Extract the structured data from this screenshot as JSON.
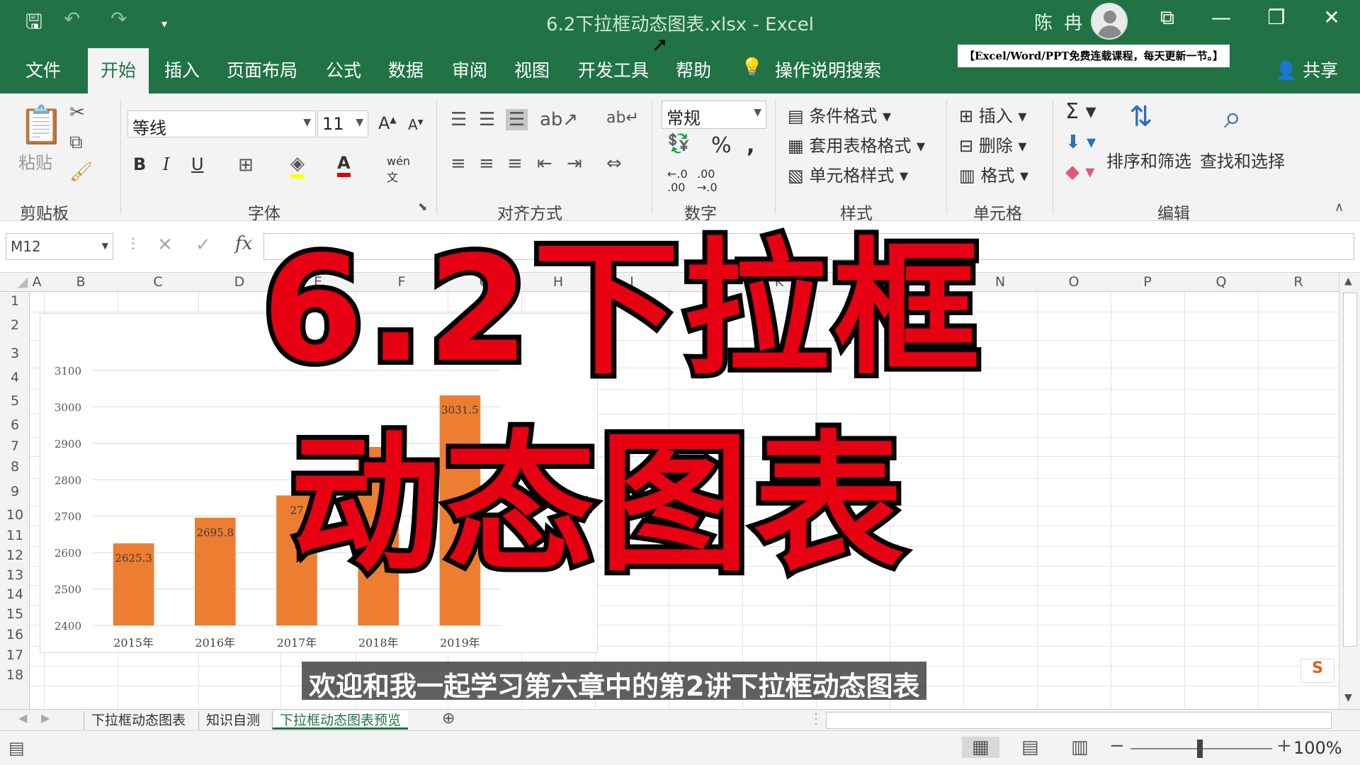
{
  "window": {
    "title": "6.2下拉框动态图表.xlsx  -  Excel",
    "user": "陈 冉",
    "notice": "【Excel/Word/PPT免费连载课程，每天更新一节。】",
    "share": "共享"
  },
  "ribbon_tabs": [
    "文件",
    "开始",
    "插入",
    "页面布局",
    "公式",
    "数据",
    "审阅",
    "视图",
    "开发工具",
    "帮助",
    "操作说明搜索"
  ],
  "ribbon": {
    "clipboard": {
      "paste": "粘贴",
      "label": "剪贴板"
    },
    "font": {
      "name": "等线",
      "size": "11",
      "label": "字体"
    },
    "alignment": {
      "label": "对齐方式"
    },
    "number": {
      "format": "常规",
      "label": "数字"
    },
    "styles": {
      "conditional": "条件格式",
      "table": "套用表格格式",
      "cell": "单元格样式",
      "label": "样式"
    },
    "cells": {
      "insert": "插入",
      "delete": "删除",
      "format": "格式",
      "label": "单元格"
    },
    "editing": {
      "sort": "排序和筛选",
      "find": "查找和选择",
      "label": "编辑"
    }
  },
  "formula_bar": {
    "name_box": "M12",
    "fx": "fx"
  },
  "columns": [
    "A",
    "B",
    "C",
    "D",
    "E",
    "F",
    "G",
    "H",
    "I",
    "J",
    "K",
    "L",
    "M",
    "N",
    "O",
    "P",
    "Q",
    "R"
  ],
  "rows": [
    "1",
    "2",
    "3",
    "4",
    "5",
    "6",
    "7",
    "8",
    "9",
    "10",
    "11",
    "12",
    "13",
    "14",
    "15",
    "16",
    "17",
    "18"
  ],
  "chart_data": {
    "type": "bar",
    "categories": [
      "2015年",
      "2016年",
      "2017年",
      "2018年",
      "2019年"
    ],
    "values": [
      2625.3,
      2695.8,
      2757,
      2890,
      3031.5
    ],
    "data_labels": [
      "2625.3",
      "2695.8",
      "27",
      "",
      "3031.5"
    ],
    "ylim": [
      2400,
      3100
    ],
    "yticks": [
      "2400",
      "2500",
      "2600",
      "2700",
      "2800",
      "2900",
      "3000",
      "3100"
    ],
    "bar_color": "#ed7d31",
    "grid": true
  },
  "sheets": [
    "下拉框动态图表",
    "知识自测",
    "下拉框动态图表预览"
  ],
  "status": {
    "zoom": "100%"
  },
  "overlay": {
    "title_line1": "6.2下拉框",
    "title_line2": "动态图表",
    "subtitle": "欢迎和我一起学习第六章中的第2讲下拉框动态图表"
  }
}
